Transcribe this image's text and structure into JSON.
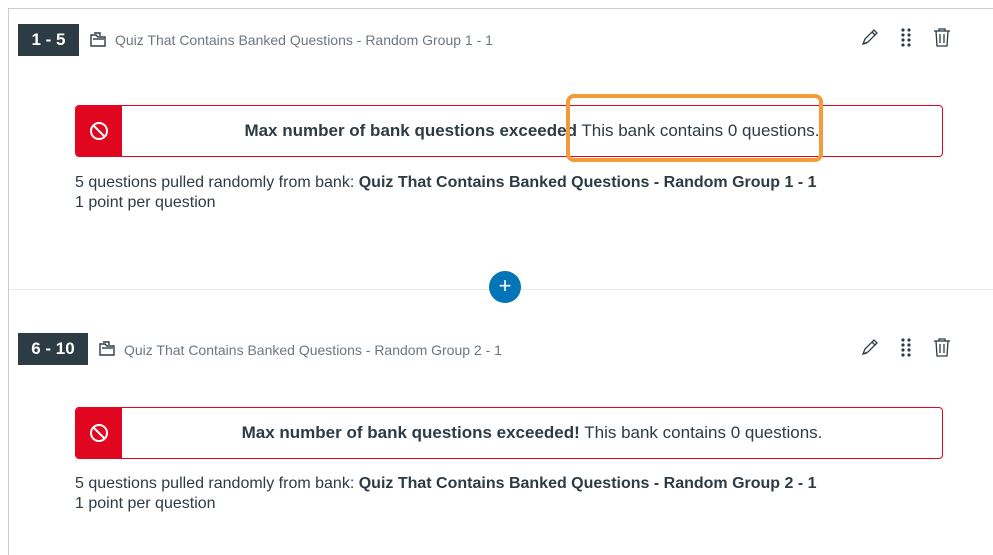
{
  "groups": [
    {
      "range": "1 - 5",
      "title": "Quiz That Contains Banked Questions - Random Group 1 - 1",
      "alert_bold": "Max number of bank questions exceeded",
      "alert_rest": "This bank contains 0 questions.",
      "desc_prefix": "5 questions pulled randomly from bank: ",
      "desc_bank": "Quiz That Contains Banked Questions - Random Group 1 - 1",
      "points": "1 point per question"
    },
    {
      "range": "6 - 10",
      "title": "Quiz That Contains Banked Questions - Random Group 2 - 1",
      "alert_bold": "Max number of bank questions exceeded!",
      "alert_rest": "This bank contains 0 questions.",
      "desc_prefix": "5 questions pulled randomly from bank: ",
      "desc_bank": "Quiz That Contains Banked Questions - Random Group 2 - 1",
      "points": "1 point per question"
    }
  ],
  "add_button": {
    "label": "+"
  },
  "icons": {
    "edit": "pencil-icon",
    "drag": "drag-handle-icon",
    "delete": "trash-icon",
    "bank": "bank-folder-icon",
    "alert": "no-entry-icon"
  },
  "colors": {
    "badge_bg": "#2d3b45",
    "alert_red": "#e0061f",
    "accent_blue": "#0374b5",
    "highlight_orange": "#f39a3c"
  }
}
